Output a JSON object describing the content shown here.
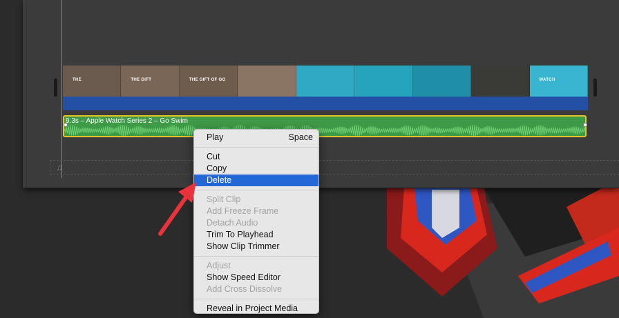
{
  "timeline": {
    "clip_label": "9.3s – Apple Watch Series 2 – Go Swim",
    "music_icon": "music-note-icon",
    "thumbnails": [
      {
        "caption": "THE",
        "color": "#6b5a4e"
      },
      {
        "caption": "THE GIFT",
        "color": "#7a6656"
      },
      {
        "caption": "THE GIFT OF GO",
        "color": "#6e5c4c"
      },
      {
        "caption": "",
        "color": "#8a7564"
      },
      {
        "caption": "",
        "color": "#2fa9c4"
      },
      {
        "caption": "",
        "color": "#27a4bd"
      },
      {
        "caption": "",
        "color": "#1f8fa8"
      },
      {
        "caption": "",
        "color": "#3a3a36"
      },
      {
        "caption": "WATCH",
        "color": "#39b4d1"
      }
    ]
  },
  "context_menu": {
    "items": [
      {
        "label": "Play",
        "shortcut": "Space",
        "enabled": true
      },
      {
        "separator": true
      },
      {
        "label": "Cut",
        "enabled": true
      },
      {
        "label": "Copy",
        "enabled": true
      },
      {
        "label": "Delete",
        "enabled": true,
        "highlighted": true
      },
      {
        "separator": true
      },
      {
        "label": "Split Clip",
        "enabled": false
      },
      {
        "label": "Add Freeze Frame",
        "enabled": false
      },
      {
        "label": "Detach Audio",
        "enabled": false
      },
      {
        "label": "Trim To Playhead",
        "enabled": true
      },
      {
        "label": "Show Clip Trimmer",
        "enabled": true
      },
      {
        "separator": true
      },
      {
        "label": "Adjust",
        "enabled": false
      },
      {
        "label": "Show Speed Editor",
        "enabled": true
      },
      {
        "label": "Add Cross Dissolve",
        "enabled": false
      },
      {
        "separator": true
      },
      {
        "label": "Reveal in Project Media",
        "enabled": true
      }
    ]
  },
  "colors": {
    "menu_highlight": "#2467d7",
    "annotation_arrow": "#e8323c",
    "audio_clip": "#3f9a47",
    "selection_border": "#e3c32c",
    "video_bar": "#2350a4"
  }
}
